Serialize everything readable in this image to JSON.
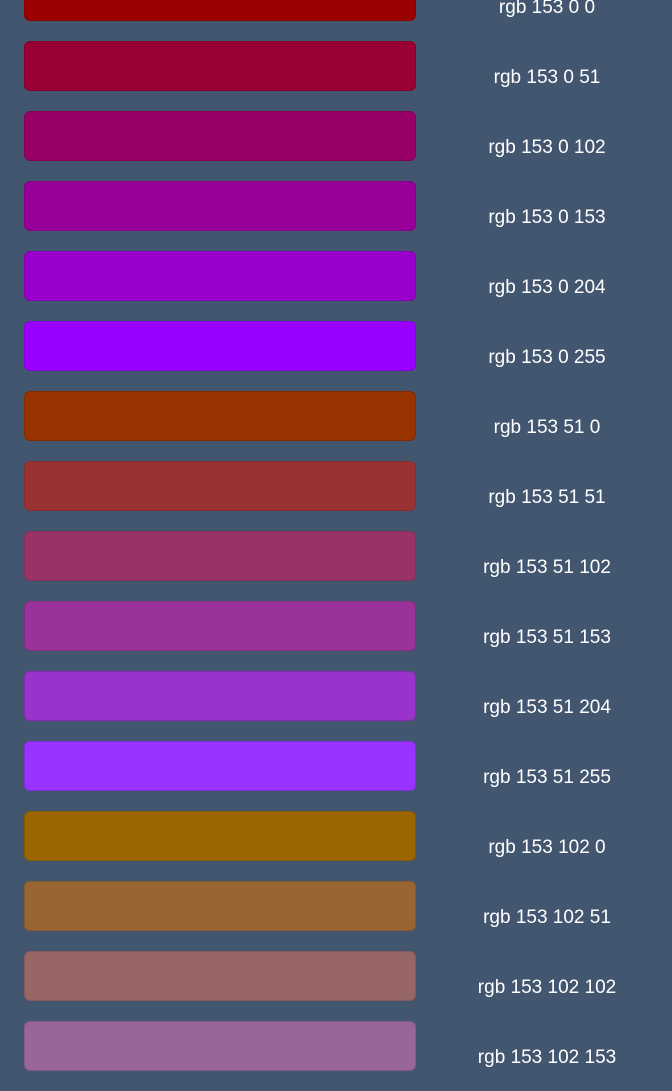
{
  "swatches": [
    {
      "label": "rgb 153 0 0",
      "color": "#990000"
    },
    {
      "label": "rgb 153 0 51",
      "color": "#990033"
    },
    {
      "label": "rgb 153 0 102",
      "color": "#990066"
    },
    {
      "label": "rgb 153 0 153",
      "color": "#990099"
    },
    {
      "label": "rgb 153 0 204",
      "color": "#9900cc"
    },
    {
      "label": "rgb 153 0 255",
      "color": "#9900ff"
    },
    {
      "label": "rgb 153 51 0",
      "color": "#993300"
    },
    {
      "label": "rgb 153 51 51",
      "color": "#993333"
    },
    {
      "label": "rgb 153 51 102",
      "color": "#993366"
    },
    {
      "label": "rgb 153 51 153",
      "color": "#993399"
    },
    {
      "label": "rgb 153 51 204",
      "color": "#9933cc"
    },
    {
      "label": "rgb 153 51 255",
      "color": "#9933ff"
    },
    {
      "label": "rgb 153 102 0",
      "color": "#996600"
    },
    {
      "label": "rgb 153 102 51",
      "color": "#996633"
    },
    {
      "label": "rgb 153 102 102",
      "color": "#996666"
    },
    {
      "label": "rgb 153 102 153",
      "color": "#996699"
    }
  ]
}
